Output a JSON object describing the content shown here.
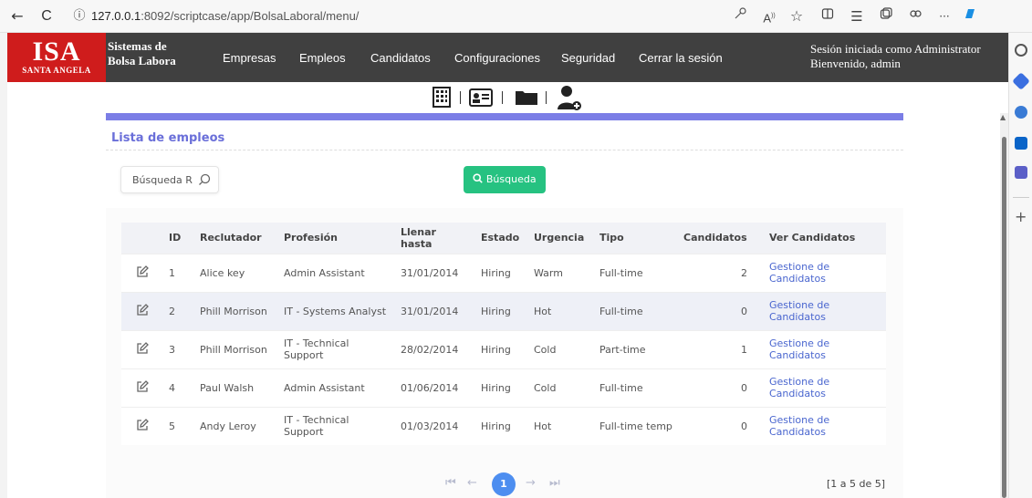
{
  "browser": {
    "back_icon": "←",
    "refresh_icon": "C",
    "info_icon": "ⓘ",
    "url_host": "127.0.0.1",
    "url_path": ":8092/scriptcase/app/BolsaLaboral/menu/",
    "more_icon": "···"
  },
  "header": {
    "logo_big": "ISA",
    "logo_small": "SANTA ANGELA",
    "system_name_line1": "Sistemas de",
    "system_name_line2": "Bolsa Labora",
    "menu": [
      "Empresas",
      "Empleos",
      "Candidatos",
      "Configuraciones",
      "Seguridad",
      "Cerrar la sesión"
    ],
    "session_line1": "Sesión iniciada como Administrator",
    "session_line2": "Bienvenido, admin"
  },
  "toolbar": {
    "icons": [
      "building-icon",
      "id-card-icon",
      "folder-icon",
      "user-add-icon"
    ]
  },
  "page": {
    "title": "Lista de empleos",
    "search_placeholder": "Búsqueda Rá",
    "search_button": "Búsqueda",
    "accent_color": "#7b7ee6",
    "button_color": "#26c281"
  },
  "table": {
    "columns": [
      "",
      "ID",
      "Reclutador",
      "Profesión",
      "Llenar hasta",
      "Estado",
      "Urgencia",
      "Tipo",
      "Candidatos",
      "Ver Candidatos"
    ],
    "rows": [
      {
        "id": "1",
        "recruiter": "Alice key",
        "profession": "Admin Assistant",
        "fill_until": "31/01/2014",
        "status": "Hiring",
        "urgency": "Warm",
        "type": "Full-time",
        "candidates": "2",
        "link": "Gestione de Candidatos"
      },
      {
        "id": "2",
        "recruiter": "Phill Morrison",
        "profession": "IT - Systems Analyst",
        "fill_until": "31/01/2014",
        "status": "Hiring",
        "urgency": "Hot",
        "type": "Full-time",
        "candidates": "0",
        "link": "Gestione de Candidatos"
      },
      {
        "id": "3",
        "recruiter": "Phill Morrison",
        "profession": "IT - Technical Support",
        "fill_until": "28/02/2014",
        "status": "Hiring",
        "urgency": "Cold",
        "type": "Part-time",
        "candidates": "1",
        "link": "Gestione de Candidatos"
      },
      {
        "id": "4",
        "recruiter": "Paul Walsh",
        "profession": "Admin Assistant",
        "fill_until": "01/06/2014",
        "status": "Hiring",
        "urgency": "Cold",
        "type": "Full-time",
        "candidates": "0",
        "link": "Gestione de Candidatos"
      },
      {
        "id": "5",
        "recruiter": "Andy Leroy",
        "profession": "IT - Technical Support",
        "fill_until": "01/03/2014",
        "status": "Hiring",
        "urgency": "Hot",
        "type": "Full-time temp",
        "candidates": "0",
        "link": "Gestione de Candidatos"
      }
    ]
  },
  "pagination": {
    "current_page": "1",
    "summary": "[1 a 5 de 5]"
  }
}
